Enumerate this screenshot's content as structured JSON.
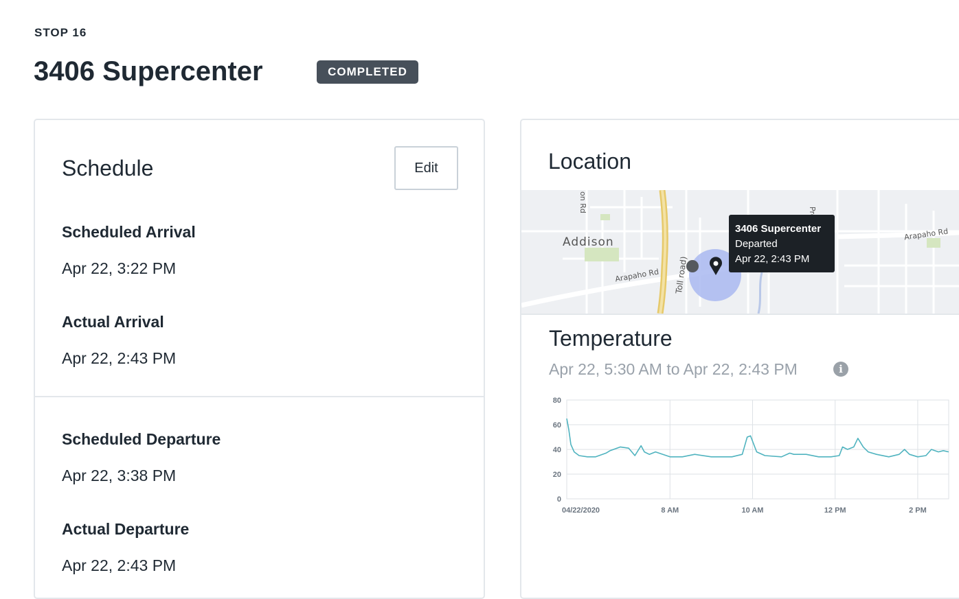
{
  "header": {
    "eyebrow": "STOP 16",
    "title": "3406 Supercenter",
    "status_badge": "COMPLETED"
  },
  "schedule": {
    "title": "Schedule",
    "edit_label": "Edit",
    "fields": [
      {
        "label": "Scheduled Arrival",
        "value": "Apr 22, 3:22 PM"
      },
      {
        "label": "Actual Arrival",
        "value": "Apr 22, 2:43 PM"
      },
      {
        "label": "Scheduled Departure",
        "value": "Apr 22, 3:38 PM"
      },
      {
        "label": "Actual Departure",
        "value": "Apr 22, 2:43 PM"
      }
    ]
  },
  "location": {
    "title": "Location",
    "map": {
      "labels": {
        "city": "Addison",
        "road_arapaho_left": "Arapaho Rd",
        "road_arapaho_right": "Arapaho Rd",
        "road_preston": "Preston Rd",
        "road_toll": "Toll road)",
        "road_edge": "on Rd"
      },
      "tooltip": {
        "name": "3406 Supercenter",
        "status": "Departed",
        "time": "Apr 22, 2:43 PM"
      },
      "colors": {
        "accuracy_circle": "#a9b9f0",
        "marker": "#55595e"
      }
    }
  },
  "temperature": {
    "title": "Temperature",
    "range": "Apr 22, 5:30 AM to Apr 22, 2:43 PM",
    "info_icon": "info-icon"
  },
  "chart_data": {
    "type": "line",
    "title": "",
    "xlabel": "",
    "ylabel": "",
    "x_ticks": [
      "04/22/2020",
      "8 AM",
      "10 AM",
      "12 PM",
      "2 PM"
    ],
    "x_tick_hours": [
      5.5,
      8,
      10,
      12,
      14
    ],
    "y_ticks": [
      0,
      20,
      40,
      60,
      80
    ],
    "ylim": [
      0,
      80
    ],
    "xlim": [
      5.5,
      14.75
    ],
    "grid": true,
    "line_color": "#4fb3bf",
    "series": [
      {
        "x": [
          5.5,
          5.55,
          5.6,
          5.68,
          5.8,
          6.0,
          6.2,
          6.45,
          6.55,
          6.8,
          7.0,
          7.15,
          7.3,
          7.38,
          7.5,
          7.65,
          8.0,
          8.3,
          8.6,
          9.0,
          9.3,
          9.5,
          9.75,
          9.87,
          9.95,
          10.1,
          10.3,
          10.7,
          10.9,
          11.0,
          11.3,
          11.6,
          11.9,
          12.1,
          12.18,
          12.3,
          12.45,
          12.55,
          12.68,
          12.8,
          13.0,
          13.3,
          13.55,
          13.68,
          13.8,
          14.0,
          14.2,
          14.33,
          14.5,
          14.62,
          14.75
        ],
        "values": [
          65,
          56,
          44,
          38,
          35,
          34,
          34,
          37,
          39,
          42,
          41,
          35,
          43,
          38,
          36,
          38,
          34,
          34,
          36,
          34,
          34,
          34,
          36,
          50,
          51,
          38,
          35,
          34,
          37,
          36,
          36,
          34,
          34,
          35,
          42,
          40,
          42,
          49,
          42,
          38,
          36,
          34,
          36,
          40,
          36,
          34,
          35,
          40,
          38,
          39,
          38
        ]
      }
    ]
  }
}
